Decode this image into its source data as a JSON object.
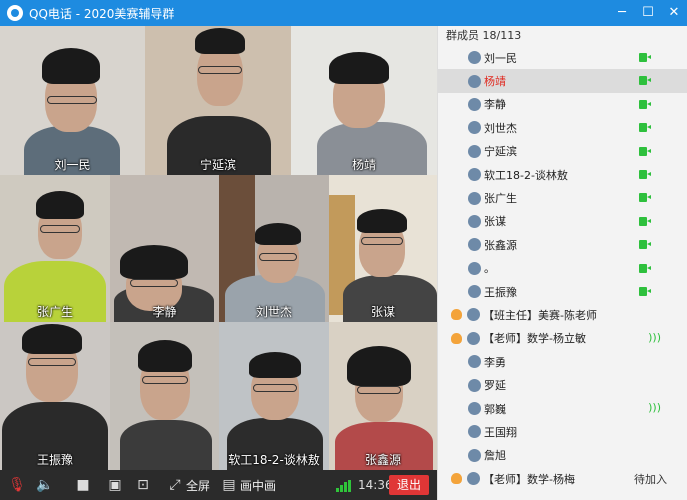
{
  "window": {
    "title": "QQ电话 - 2020美赛辅导群",
    "minimize": "─",
    "maximize": "☐",
    "close": "✕"
  },
  "video_tiles": [
    {
      "name": "刘一民"
    },
    {
      "name": "宁延滨"
    },
    {
      "name": "杨靖"
    },
    {
      "name": "张广生"
    },
    {
      "name": "李静"
    },
    {
      "name": "刘世杰"
    },
    {
      "name": "张谋"
    },
    {
      "name": "王振豫"
    },
    {
      "name": ""
    },
    {
      "name": "软工18-2-谈林敖"
    },
    {
      "name": "张鑫源"
    }
  ],
  "toolbar": {
    "fullscreen_label": "全屏",
    "pip_label": "画中画",
    "time": "14:36",
    "exit_label": "退出"
  },
  "members": {
    "header": "群成员 18/113",
    "list": [
      {
        "name": "刘一民",
        "video": true
      },
      {
        "name": "杨靖",
        "video": true,
        "selected": true,
        "red": true
      },
      {
        "name": "李静",
        "video": true
      },
      {
        "name": "刘世杰",
        "video": true
      },
      {
        "name": "宁延滨",
        "video": true
      },
      {
        "name": "软工18-2-谈林敖",
        "video": true
      },
      {
        "name": "张广生",
        "video": true
      },
      {
        "name": "张谋",
        "video": true
      },
      {
        "name": "张鑫源",
        "video": true
      },
      {
        "name": "。",
        "video": true
      },
      {
        "name": "王振豫",
        "video": true
      },
      {
        "name": "【班主任】美赛-陈老师",
        "tag": true
      },
      {
        "name": "【老师】数学-杨立敏",
        "tag": true,
        "voice": true
      },
      {
        "name": "李勇"
      },
      {
        "name": "罗延"
      },
      {
        "name": "郭巍",
        "voice": true
      },
      {
        "name": "王国翔"
      },
      {
        "name": "詹旭"
      },
      {
        "name": "【老师】数学-杨梅",
        "tag": true,
        "status": "待加入"
      }
    ]
  },
  "colors": {
    "titlebar": "#1e8be0",
    "video_on": "#2ec03d",
    "exit": "#e03636",
    "selected_name": "#e0291f"
  }
}
